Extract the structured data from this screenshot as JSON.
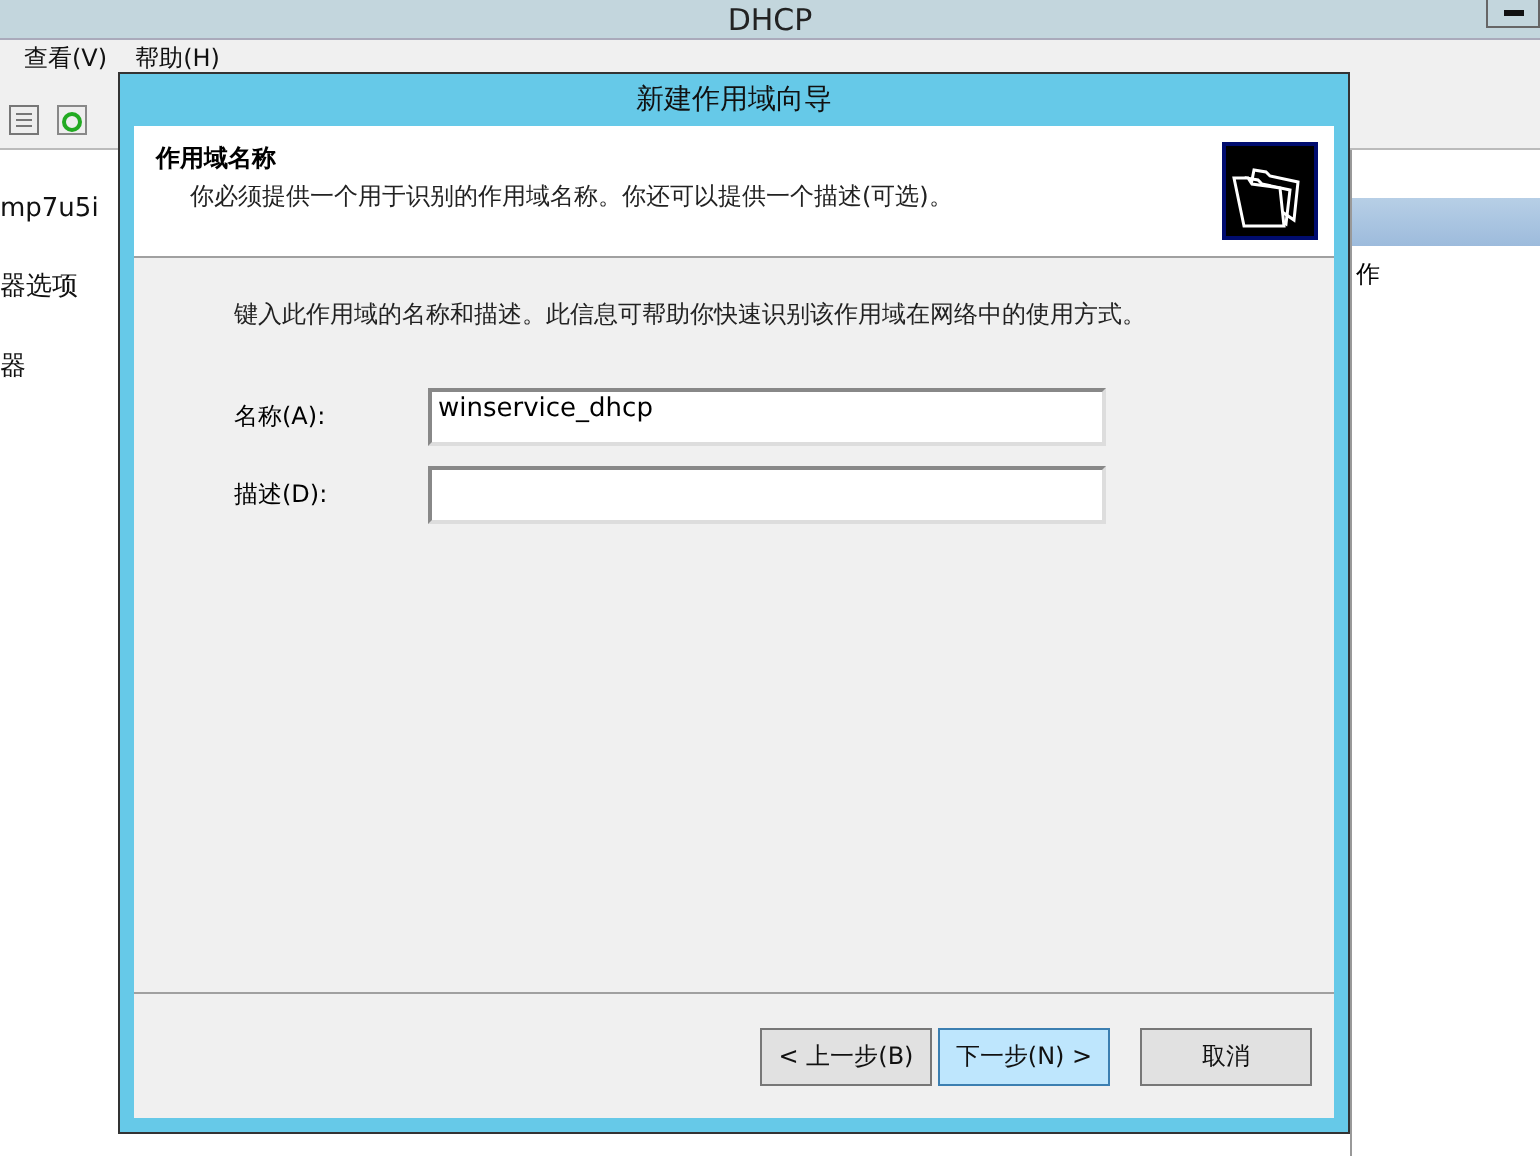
{
  "window": {
    "title": "DHCP"
  },
  "menu": [
    "查看(V)",
    "帮助(H)"
  ],
  "tree": [
    "mp7u5i",
    "器选项",
    "器"
  ],
  "actions_panel": {
    "item": "作"
  },
  "dialog": {
    "title": "新建作用域向导",
    "header": {
      "title": "作用域名称",
      "subtitle": "你必须提供一个用于识别的作用域名称。你还可以提供一个描述(可选)。"
    },
    "intro": "键入此作用域的名称和描述。此信息可帮助你快速识别该作用域在网络中的使用方式。",
    "fields": [
      {
        "label": "名称(A):",
        "value": "winservice_dhcp"
      },
      {
        "label": "描述(D):"
      }
    ],
    "buttons": [
      {
        "label": "< 上一步(B)",
        "selected": false
      },
      {
        "label": "下一步(N) >",
        "selected": true
      },
      {
        "label": "取消",
        "selected": false
      }
    ]
  }
}
